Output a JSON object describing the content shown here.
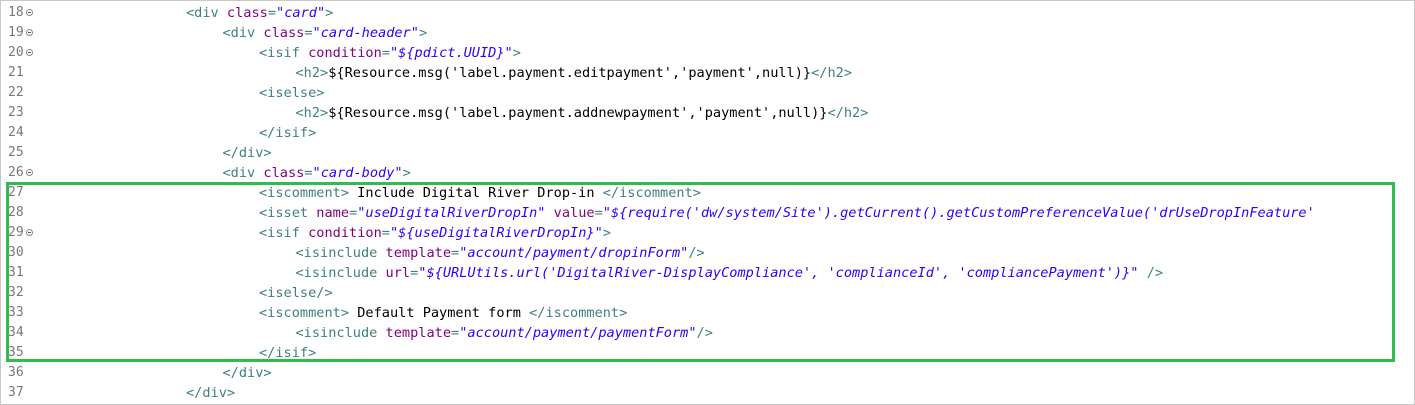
{
  "lines": [
    {
      "n": "18",
      "fold": true,
      "indent": 4,
      "parts": [
        [
          "tag",
          "<div "
        ],
        [
          "attr",
          "class"
        ],
        [
          "tag",
          "="
        ],
        [
          "val",
          "\"card\""
        ],
        [
          "tag",
          ">"
        ]
      ]
    },
    {
      "n": "19",
      "fold": true,
      "indent": 5,
      "parts": [
        [
          "tag",
          "<div "
        ],
        [
          "attr",
          "class"
        ],
        [
          "tag",
          "="
        ],
        [
          "val",
          "\"card-header\""
        ],
        [
          "tag",
          ">"
        ]
      ]
    },
    {
      "n": "20",
      "fold": true,
      "indent": 6,
      "parts": [
        [
          "tag",
          "<isif "
        ],
        [
          "attr",
          "condition"
        ],
        [
          "tag",
          "="
        ],
        [
          "val",
          "\"${pdict.UUID}\""
        ],
        [
          "tag",
          ">"
        ]
      ]
    },
    {
      "n": "21",
      "fold": false,
      "indent": 7,
      "parts": [
        [
          "tag",
          "<h2>"
        ],
        [
          "txt",
          "${Resource.msg('label.payment.editpayment','payment',null)}"
        ],
        [
          "tag",
          "</h2>"
        ]
      ]
    },
    {
      "n": "22",
      "fold": false,
      "indent": 6,
      "parts": [
        [
          "tag",
          "<iselse>"
        ]
      ]
    },
    {
      "n": "23",
      "fold": false,
      "indent": 7,
      "parts": [
        [
          "tag",
          "<h2>"
        ],
        [
          "txt",
          "${Resource.msg('label.payment.addnewpayment','payment',null)}"
        ],
        [
          "tag",
          "</h2>"
        ]
      ]
    },
    {
      "n": "24",
      "fold": false,
      "indent": 6,
      "parts": [
        [
          "tag",
          "</isif>"
        ]
      ]
    },
    {
      "n": "25",
      "fold": false,
      "indent": 5,
      "parts": [
        [
          "tag",
          "</div>"
        ]
      ]
    },
    {
      "n": "26",
      "fold": true,
      "indent": 5,
      "parts": [
        [
          "tag",
          "<div "
        ],
        [
          "attr",
          "class"
        ],
        [
          "tag",
          "="
        ],
        [
          "val",
          "\"card-body\""
        ],
        [
          "tag",
          ">"
        ]
      ]
    },
    {
      "n": "27",
      "fold": false,
      "indent": 6,
      "parts": [
        [
          "tag",
          "<iscomment>"
        ],
        [
          "txt",
          " Include Digital River Drop-in "
        ],
        [
          "tag",
          "</iscomment>"
        ]
      ]
    },
    {
      "n": "28",
      "fold": false,
      "indent": 6,
      "parts": [
        [
          "tag",
          "<isset "
        ],
        [
          "attr",
          "name"
        ],
        [
          "tag",
          "="
        ],
        [
          "val",
          "\"useDigitalRiverDropIn\""
        ],
        [
          "txt",
          " "
        ],
        [
          "attr",
          "value"
        ],
        [
          "tag",
          "="
        ],
        [
          "val",
          "\"${require('dw/system/Site').getCurrent().getCustomPreferenceValue('drUseDropInFeature'"
        ]
      ]
    },
    {
      "n": "29",
      "fold": true,
      "indent": 6,
      "parts": [
        [
          "tag",
          "<isif "
        ],
        [
          "attr",
          "condition"
        ],
        [
          "tag",
          "="
        ],
        [
          "val",
          "\"${useDigitalRiverDropIn}\""
        ],
        [
          "tag",
          ">"
        ]
      ]
    },
    {
      "n": "30",
      "fold": false,
      "indent": 7,
      "parts": [
        [
          "tag",
          "<isinclude "
        ],
        [
          "attr",
          "template"
        ],
        [
          "tag",
          "="
        ],
        [
          "val",
          "\"account/payment/dropinForm\""
        ],
        [
          "tag",
          "/>"
        ]
      ]
    },
    {
      "n": "31",
      "fold": false,
      "indent": 7,
      "parts": [
        [
          "tag",
          "<isinclude "
        ],
        [
          "attr",
          "url"
        ],
        [
          "tag",
          "="
        ],
        [
          "val",
          "\"${URLUtils.url('DigitalRiver-DisplayCompliance', 'complianceId', 'compliancePayment')}\""
        ],
        [
          "txt",
          " "
        ],
        [
          "tag",
          "/>"
        ]
      ]
    },
    {
      "n": "32",
      "fold": false,
      "indent": 6,
      "parts": [
        [
          "tag",
          "<iselse/>"
        ]
      ]
    },
    {
      "n": "33",
      "fold": false,
      "indent": 6,
      "parts": [
        [
          "tag",
          "<iscomment>"
        ],
        [
          "txt",
          " Default Payment form "
        ],
        [
          "tag",
          "</iscomment>"
        ]
      ]
    },
    {
      "n": "34",
      "fold": false,
      "indent": 7,
      "parts": [
        [
          "tag",
          "<isinclude "
        ],
        [
          "attr",
          "template"
        ],
        [
          "tag",
          "="
        ],
        [
          "val",
          "\"account/payment/paymentForm\""
        ],
        [
          "tag",
          "/>"
        ]
      ]
    },
    {
      "n": "35",
      "fold": false,
      "indent": 6,
      "parts": [
        [
          "tag",
          "</isif>"
        ]
      ]
    },
    {
      "n": "36",
      "fold": false,
      "indent": 5,
      "parts": [
        [
          "tag",
          "</div>"
        ]
      ]
    },
    {
      "n": "37",
      "fold": false,
      "indent": 4,
      "parts": [
        [
          "tag",
          "</div>"
        ]
      ]
    }
  ],
  "colors": {
    "highlight_border": "#2ebd4e",
    "tag": "#3f7f7f",
    "attr": "#7f007f",
    "value": "#2a00ff",
    "text": "#000000"
  }
}
